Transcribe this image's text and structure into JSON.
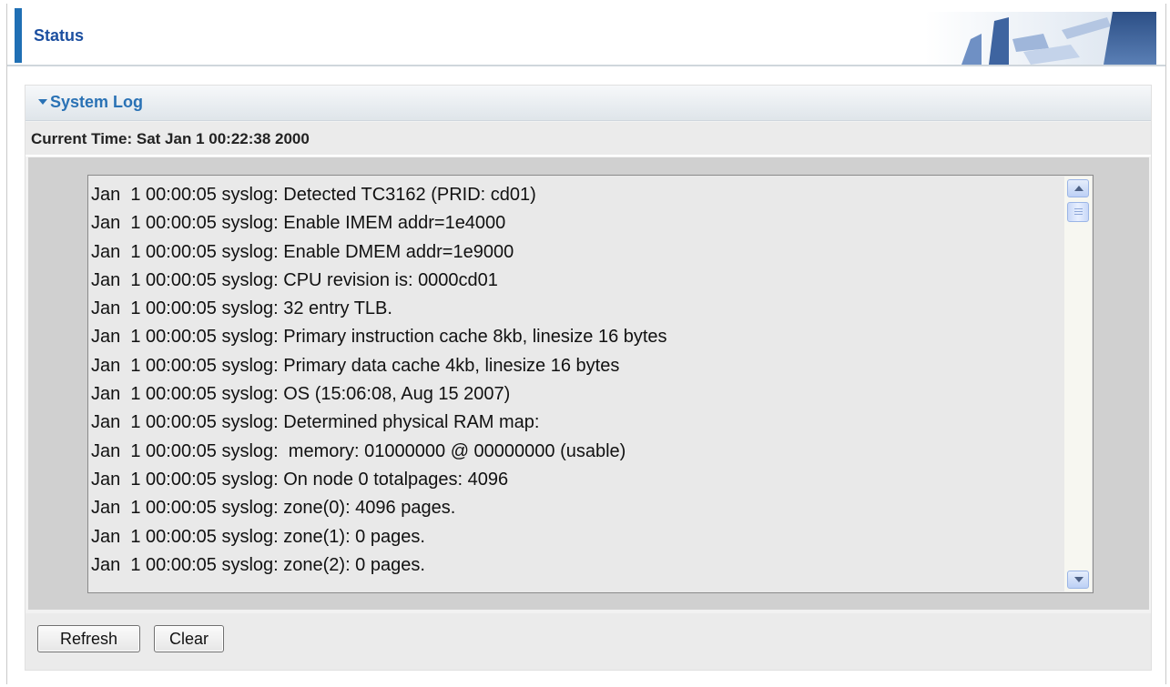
{
  "header": {
    "title": "Status"
  },
  "section": {
    "title": "System Log",
    "current_time_label": "Current Time: Sat Jan 1 00:22:38 2000"
  },
  "log": {
    "lines": [
      "Jan  1 00:00:05 syslog: Detected TC3162 (PRID: cd01)",
      "Jan  1 00:00:05 syslog: Enable IMEM addr=1e4000",
      "Jan  1 00:00:05 syslog: Enable DMEM addr=1e9000",
      "Jan  1 00:00:05 syslog: CPU revision is: 0000cd01",
      "Jan  1 00:00:05 syslog: 32 entry TLB.",
      "Jan  1 00:00:05 syslog: Primary instruction cache 8kb, linesize 16 bytes",
      "Jan  1 00:00:05 syslog: Primary data cache 4kb, linesize 16 bytes",
      "Jan  1 00:00:05 syslog: OS (15:06:08, Aug 15 2007)",
      "Jan  1 00:00:05 syslog: Determined physical RAM map:",
      "Jan  1 00:00:05 syslog:  memory: 01000000 @ 00000000 (usable)",
      "Jan  1 00:00:05 syslog: On node 0 totalpages: 4096",
      "Jan  1 00:00:05 syslog: zone(0): 4096 pages.",
      "Jan  1 00:00:05 syslog: zone(1): 0 pages.",
      "Jan  1 00:00:05 syslog: zone(2): 0 pages."
    ]
  },
  "buttons": {
    "refresh_label": "Refresh",
    "clear_label": "Clear"
  },
  "icons": {
    "section_toggle": "caret-down-icon",
    "scroll_up": "chevron-up-icon",
    "scroll_down": "chevron-down-icon"
  },
  "colors": {
    "accent": "#1f6fb4",
    "section_title": "#2a72b5",
    "log_background": "#e9e9e9"
  }
}
